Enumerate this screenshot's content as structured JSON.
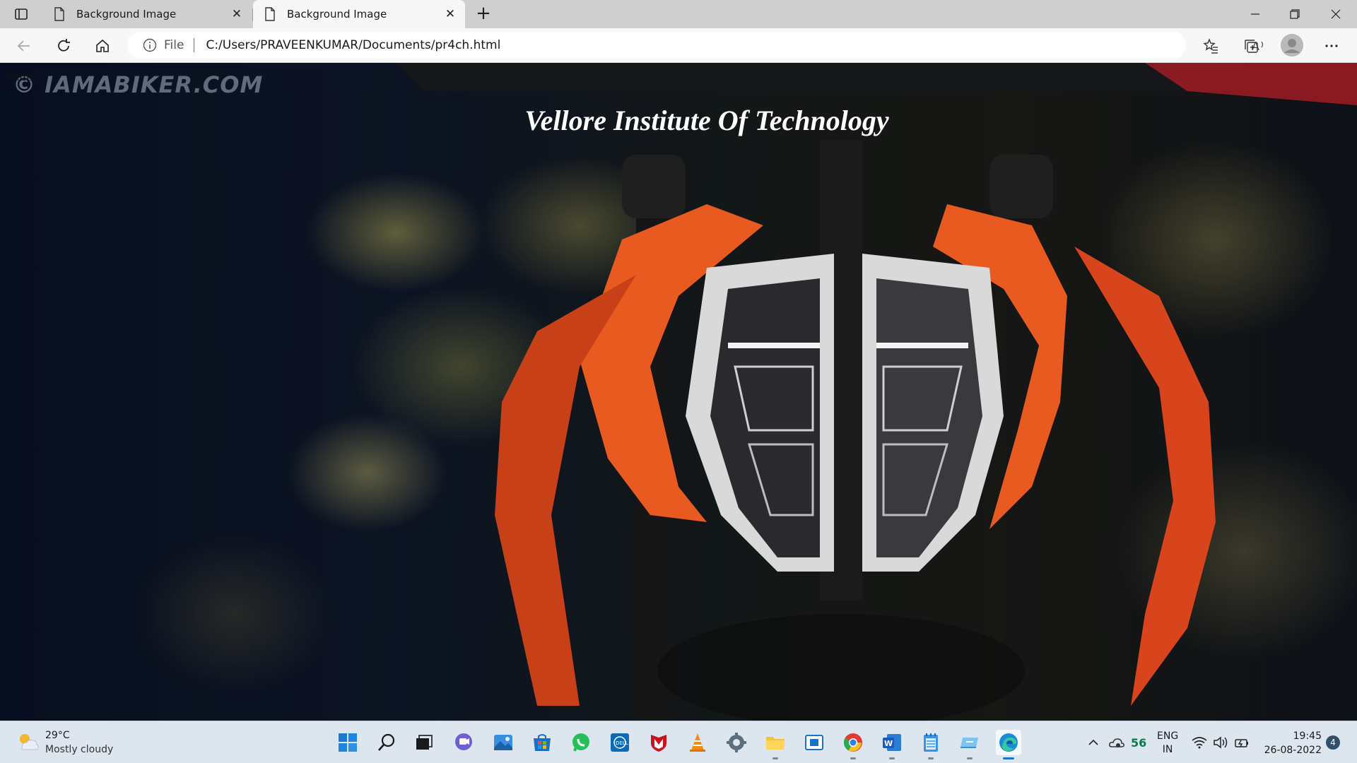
{
  "browser": {
    "tabs": [
      {
        "label": "Background Image",
        "active": false
      },
      {
        "label": "Background Image",
        "active": true
      }
    ],
    "new_tab": "+",
    "address_bar": {
      "scheme_label": "File",
      "url": "C:/Users/PRAVEENKUMAR/Documents/pr4ch.html"
    }
  },
  "page": {
    "html_text": "html",
    "watermark": "© IAMABIKER.COM",
    "heading": "Vellore Institute Of Technology"
  },
  "taskbar": {
    "weather": {
      "temp": "29°C",
      "condition": "Mostly cloudy"
    },
    "apps": [
      "start",
      "search",
      "task-view",
      "teams-chat",
      "photos",
      "store",
      "whatsapp",
      "dell",
      "mcafee",
      "vlc",
      "settings",
      "file-explorer",
      "snipping",
      "chrome",
      "word",
      "notepad",
      "cloud-app",
      "edge"
    ],
    "tray": {
      "aqi": "56",
      "language": "ENG",
      "region": "IN",
      "time": "19:45",
      "date": "26-08-2022",
      "notifications": "4"
    }
  },
  "colors": {
    "tabstrip": "#cfcfcf",
    "toolbar": "#f7f7f7",
    "taskbar": "#dde6ef",
    "bike_orange": "#e85a1f"
  }
}
